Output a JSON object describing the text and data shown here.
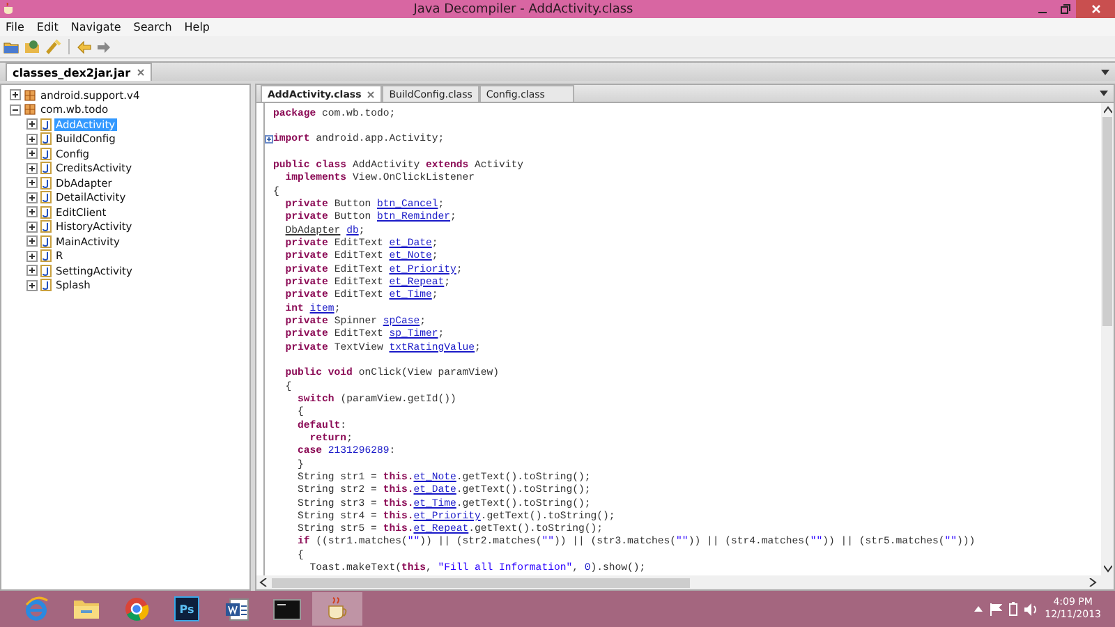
{
  "window": {
    "title": "Java Decompiler - AddActivity.class"
  },
  "menu": [
    {
      "label": "File"
    },
    {
      "label": "Edit"
    },
    {
      "label": "Navigate"
    },
    {
      "label": "Search"
    },
    {
      "label": "Help"
    }
  ],
  "toolbar": [
    {
      "kind": "open"
    },
    {
      "kind": "open-type"
    },
    {
      "kind": "wand"
    },
    {
      "kind": "separator"
    },
    {
      "kind": "back"
    },
    {
      "kind": "forward"
    }
  ],
  "jar_tabs": [
    {
      "label": "classes_dex2jar.jar",
      "selected": true
    }
  ],
  "tree": [
    {
      "label": "android.support.v4",
      "kind": "package",
      "expanded": false,
      "selected": false
    },
    {
      "label": "com.wb.todo",
      "kind": "package",
      "expanded": true,
      "selected": false,
      "children": [
        {
          "label": "AddActivity",
          "kind": "class",
          "expanded": false,
          "selected": true
        },
        {
          "label": "BuildConfig",
          "kind": "class",
          "expanded": false,
          "selected": false
        },
        {
          "label": "Config",
          "kind": "class",
          "expanded": false,
          "selected": false
        },
        {
          "label": "CreditsActivity",
          "kind": "class",
          "expanded": false,
          "selected": false
        },
        {
          "label": "DbAdapter",
          "kind": "class",
          "expanded": false,
          "selected": false
        },
        {
          "label": "DetailActivity",
          "kind": "class",
          "expanded": false,
          "selected": false
        },
        {
          "label": "EditClient",
          "kind": "class",
          "expanded": false,
          "selected": false
        },
        {
          "label": "HistoryActivity",
          "kind": "class",
          "expanded": false,
          "selected": false
        },
        {
          "label": "MainActivity",
          "kind": "class",
          "expanded": false,
          "selected": false
        },
        {
          "label": "R",
          "kind": "class",
          "expanded": false,
          "selected": false
        },
        {
          "label": "SettingActivity",
          "kind": "class",
          "expanded": false,
          "selected": false
        },
        {
          "label": "Splash",
          "kind": "class",
          "expanded": false,
          "selected": false
        }
      ]
    }
  ],
  "editor_tabs": [
    {
      "label": "AddActivity.class",
      "selected": true
    },
    {
      "label": "BuildConfig.class",
      "selected": false
    },
    {
      "label": "Config.class",
      "selected": false
    }
  ],
  "code": [
    {
      "kind": "code",
      "tokens": [
        {
          "kind": "kw",
          "text": "package"
        },
        {
          "kind": "plain",
          "text": " com.wb.todo;"
        }
      ]
    },
    {
      "kind": "blank"
    },
    {
      "kind": "folded",
      "tokens": [
        {
          "kind": "kw",
          "text": "import"
        },
        {
          "kind": "plain",
          "text": " android.app.Activity;"
        }
      ]
    },
    {
      "kind": "blank"
    },
    {
      "kind": "code",
      "tokens": [
        {
          "kind": "kw",
          "text": "public class"
        },
        {
          "kind": "plain",
          "text": " AddActivity "
        },
        {
          "kind": "kw",
          "text": "extends"
        },
        {
          "kind": "plain",
          "text": " Activity"
        }
      ]
    },
    {
      "kind": "code",
      "tokens": [
        {
          "kind": "kw",
          "text": "  implements"
        },
        {
          "kind": "plain",
          "text": " View.OnClickListener"
        }
      ]
    },
    {
      "kind": "code",
      "tokens": [
        {
          "kind": "plain",
          "text": "{"
        }
      ]
    },
    {
      "kind": "code",
      "tokens": [
        {
          "kind": "kw",
          "text": "  private"
        },
        {
          "kind": "plain",
          "text": " Button "
        },
        {
          "kind": "field",
          "text": "btn_Cancel"
        },
        {
          "kind": "plain",
          "text": ";"
        }
      ]
    },
    {
      "kind": "code",
      "tokens": [
        {
          "kind": "kw",
          "text": "  private"
        },
        {
          "kind": "plain",
          "text": " Button "
        },
        {
          "kind": "field",
          "text": "btn_Reminder"
        },
        {
          "kind": "plain",
          "text": ";"
        }
      ]
    },
    {
      "kind": "code",
      "tokens": [
        {
          "kind": "typeref",
          "text": "  DbAdapter"
        },
        {
          "kind": "field",
          "text": " db"
        },
        {
          "kind": "plain",
          "text": ";"
        }
      ]
    },
    {
      "kind": "code",
      "tokens": [
        {
          "kind": "kw",
          "text": "  private"
        },
        {
          "kind": "plain",
          "text": " EditText "
        },
        {
          "kind": "field",
          "text": "et_Date"
        },
        {
          "kind": "plain",
          "text": ";"
        }
      ]
    },
    {
      "kind": "code",
      "tokens": [
        {
          "kind": "kw",
          "text": "  private"
        },
        {
          "kind": "plain",
          "text": " EditText "
        },
        {
          "kind": "field",
          "text": "et_Note"
        },
        {
          "kind": "plain",
          "text": ";"
        }
      ]
    },
    {
      "kind": "code",
      "tokens": [
        {
          "kind": "kw",
          "text": "  private"
        },
        {
          "kind": "plain",
          "text": " EditText "
        },
        {
          "kind": "field",
          "text": "et_Priority"
        },
        {
          "kind": "plain",
          "text": ";"
        }
      ]
    },
    {
      "kind": "code",
      "tokens": [
        {
          "kind": "kw",
          "text": "  private"
        },
        {
          "kind": "plain",
          "text": " EditText "
        },
        {
          "kind": "field",
          "text": "et_Repeat"
        },
        {
          "kind": "plain",
          "text": ";"
        }
      ]
    },
    {
      "kind": "code",
      "tokens": [
        {
          "kind": "kw",
          "text": "  private"
        },
        {
          "kind": "plain",
          "text": " EditText "
        },
        {
          "kind": "field",
          "text": "et_Time"
        },
        {
          "kind": "plain",
          "text": ";"
        }
      ]
    },
    {
      "kind": "code",
      "tokens": [
        {
          "kind": "kw",
          "text": "  int"
        },
        {
          "kind": "field",
          "text": " item"
        },
        {
          "kind": "plain",
          "text": ";"
        }
      ]
    },
    {
      "kind": "code",
      "tokens": [
        {
          "kind": "kw",
          "text": "  private"
        },
        {
          "kind": "plain",
          "text": " Spinner "
        },
        {
          "kind": "field",
          "text": "spCase"
        },
        {
          "kind": "plain",
          "text": ";"
        }
      ]
    },
    {
      "kind": "code",
      "tokens": [
        {
          "kind": "kw",
          "text": "  private"
        },
        {
          "kind": "plain",
          "text": " EditText "
        },
        {
          "kind": "field",
          "text": "sp_Timer"
        },
        {
          "kind": "plain",
          "text": ";"
        }
      ]
    },
    {
      "kind": "code",
      "tokens": [
        {
          "kind": "kw",
          "text": "  private"
        },
        {
          "kind": "plain",
          "text": " TextView "
        },
        {
          "kind": "field",
          "text": "txtRatingValue"
        },
        {
          "kind": "plain",
          "text": ";"
        }
      ]
    },
    {
      "kind": "blank"
    },
    {
      "kind": "code",
      "tokens": [
        {
          "kind": "kw",
          "text": "  public void"
        },
        {
          "kind": "plain",
          "text": " onClick(View paramView)"
        }
      ]
    },
    {
      "kind": "code",
      "tokens": [
        {
          "kind": "plain",
          "text": "  {"
        }
      ]
    },
    {
      "kind": "code",
      "tokens": [
        {
          "kind": "kw",
          "text": "    switch"
        },
        {
          "kind": "plain",
          "text": " (paramView.getId())"
        }
      ]
    },
    {
      "kind": "code",
      "tokens": [
        {
          "kind": "plain",
          "text": "    {"
        }
      ]
    },
    {
      "kind": "code",
      "tokens": [
        {
          "kind": "kw",
          "text": "    default"
        },
        {
          "kind": "plain",
          "text": ":"
        }
      ]
    },
    {
      "kind": "code",
      "tokens": [
        {
          "kind": "kw",
          "text": "      return"
        },
        {
          "kind": "plain",
          "text": ";"
        }
      ]
    },
    {
      "kind": "code",
      "tokens": [
        {
          "kind": "kw",
          "text": "    case"
        },
        {
          "kind": "num",
          "text": " 2131296289"
        },
        {
          "kind": "plain",
          "text": ":"
        }
      ]
    },
    {
      "kind": "code",
      "tokens": [
        {
          "kind": "plain",
          "text": "    }"
        }
      ]
    },
    {
      "kind": "code",
      "tokens": [
        {
          "kind": "plain",
          "text": "    String str1 = "
        },
        {
          "kind": "kw",
          "text": "this."
        },
        {
          "kind": "field",
          "text": "et_Note"
        },
        {
          "kind": "plain",
          "text": ".getText().toString();"
        }
      ]
    },
    {
      "kind": "code",
      "tokens": [
        {
          "kind": "plain",
          "text": "    String str2 = "
        },
        {
          "kind": "kw",
          "text": "this."
        },
        {
          "kind": "field",
          "text": "et_Date"
        },
        {
          "kind": "plain",
          "text": ".getText().toString();"
        }
      ]
    },
    {
      "kind": "code",
      "tokens": [
        {
          "kind": "plain",
          "text": "    String str3 = "
        },
        {
          "kind": "kw",
          "text": "this."
        },
        {
          "kind": "field",
          "text": "et_Time"
        },
        {
          "kind": "plain",
          "text": ".getText().toString();"
        }
      ]
    },
    {
      "kind": "code",
      "tokens": [
        {
          "kind": "plain",
          "text": "    String str4 = "
        },
        {
          "kind": "kw",
          "text": "this."
        },
        {
          "kind": "field",
          "text": "et_Priority"
        },
        {
          "kind": "plain",
          "text": ".getText().toString();"
        }
      ]
    },
    {
      "kind": "code",
      "tokens": [
        {
          "kind": "plain",
          "text": "    String str5 = "
        },
        {
          "kind": "kw",
          "text": "this."
        },
        {
          "kind": "field",
          "text": "et_Repeat"
        },
        {
          "kind": "plain",
          "text": ".getText().toString();"
        }
      ]
    },
    {
      "kind": "code",
      "tokens": [
        {
          "kind": "kw",
          "text": "    if"
        },
        {
          "kind": "plain",
          "text": " ((str1.matches("
        },
        {
          "kind": "str",
          "text": "\"\""
        },
        {
          "kind": "plain",
          "text": ")) || (str2.matches("
        },
        {
          "kind": "str",
          "text": "\"\""
        },
        {
          "kind": "plain",
          "text": ")) || (str3.matches("
        },
        {
          "kind": "str",
          "text": "\"\""
        },
        {
          "kind": "plain",
          "text": ")) || (str4.matches("
        },
        {
          "kind": "str",
          "text": "\"\""
        },
        {
          "kind": "plain",
          "text": ")) || (str5.matches("
        },
        {
          "kind": "str",
          "text": "\"\""
        },
        {
          "kind": "plain",
          "text": ")))"
        }
      ]
    },
    {
      "kind": "code",
      "tokens": [
        {
          "kind": "plain",
          "text": "    {"
        }
      ]
    },
    {
      "kind": "code",
      "tokens": [
        {
          "kind": "plain",
          "text": "      Toast.makeText("
        },
        {
          "kind": "kw",
          "text": "this"
        },
        {
          "kind": "plain",
          "text": ", "
        },
        {
          "kind": "str",
          "text": "\"Fill all Information\""
        },
        {
          "kind": "plain",
          "text": ", "
        },
        {
          "kind": "num",
          "text": "0"
        },
        {
          "kind": "plain",
          "text": ").show();"
        }
      ]
    }
  ],
  "taskbar": [
    {
      "kind": "browser",
      "active": false
    },
    {
      "kind": "folder",
      "active": false
    },
    {
      "kind": "chrome",
      "active": false
    },
    {
      "kind": "photoshop",
      "label": "Ps",
      "active": false
    },
    {
      "kind": "word",
      "active": false
    },
    {
      "kind": "terminal",
      "active": false
    },
    {
      "kind": "cup",
      "active": true
    }
  ],
  "clock": {
    "time": "4:09 PM",
    "date": "12/11/2013"
  }
}
